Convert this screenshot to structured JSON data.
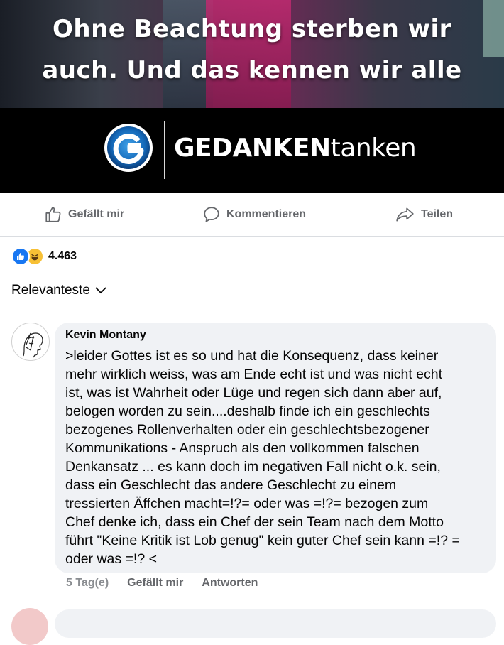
{
  "media": {
    "caption_line1": "Ohne Beachtung sterben wir",
    "caption_line2": "auch. Und das kennen wir alle",
    "brand_bold": "GEDANKEN",
    "brand_light": "tanken"
  },
  "actions": {
    "like_label": "Gefällt mir",
    "comment_label": "Kommentieren",
    "share_label": "Teilen"
  },
  "reactions": {
    "count": "4.463"
  },
  "sort": {
    "label": "Relevanteste"
  },
  "comment": {
    "author": "Kevin Montany",
    "lines": [
      ">leider Gottes ist es so und hat die Konsequenz, dass keiner",
      "mehr wirklich  weiss, was am Ende  echt ist und was  nicht echt",
      "ist, was ist Wahrheit oder Lüge und regen sich dann aber auf,",
      "belogen worden zu sein....deshalb finde ich ein geschlechts",
      "bezogenes Rollenverhalten oder ein geschlechtsbezogener",
      "Kommunikations - Anspruch als den vollkommen falschen",
      "Denkansatz ... es kann doch im negativen Fall nicht o.k. sein,",
      "dass ein Geschlecht das andere Geschlecht zu einem",
      "tressierten Äffchen macht=!?= oder was =!?= bezogen zum",
      "Chef denke ich, dass ein Chef der sein Team nach dem Motto",
      "führt \"Keine Kritik ist Lob genug\" kein guter Chef sein kann =!? =",
      "oder was =!? <"
    ],
    "time": "5 Tag(e)",
    "like_label": "Gefällt mir",
    "reply_label": "Antworten"
  },
  "colors": {
    "facebook_blue": "#1877f2",
    "secondary_text": "#65676b",
    "bubble_bg": "#f0f2f5"
  }
}
